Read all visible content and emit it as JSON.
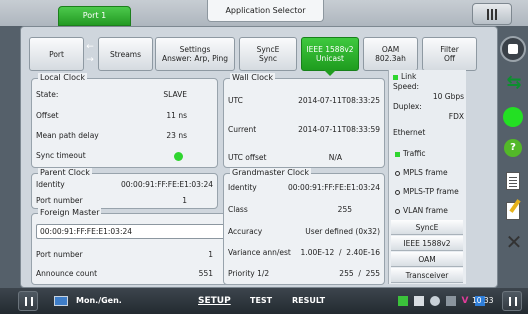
{
  "top": {
    "port_label": "Port 1",
    "app_selector_label": "Application Selector"
  },
  "tabs": [
    {
      "line1": "Port",
      "line2": ""
    },
    {
      "line1": "Streams",
      "line2": ""
    },
    {
      "line1": "Settings",
      "line2": "Answer: Arp, Ping"
    },
    {
      "line1": "SyncE",
      "line2": "Sync"
    },
    {
      "line1": "IEEE 1588v2",
      "line2": "Unicast"
    },
    {
      "line1": "OAM",
      "line2": "802.3ah"
    },
    {
      "line1": "Filter",
      "line2": "Off"
    }
  ],
  "local_clock": {
    "title": "Local Clock",
    "rows": [
      {
        "label": "State:",
        "value": "SLAVE"
      },
      {
        "label": "Offset",
        "value": "11 ns"
      },
      {
        "label": "Mean path delay",
        "value": "23 ns"
      },
      {
        "label": "Sync timeout",
        "value": ""
      }
    ]
  },
  "parent_clock": {
    "title": "Parent Clock",
    "rows": [
      {
        "label": "Identity",
        "value": "00:00:91:FF:FE:E1:03:24"
      },
      {
        "label": "Port number",
        "value": "1"
      }
    ]
  },
  "foreign_master": {
    "title": "Foreign Master",
    "selected": "00:00:91:FF:FE:E1:03:24",
    "rows": [
      {
        "label": "Port number",
        "value": "1"
      },
      {
        "label": "Announce count",
        "value": "551"
      }
    ]
  },
  "wall_clock": {
    "title": "Wall Clock",
    "rows": [
      {
        "label": "UTC",
        "value": "2014-07-11T08:33:25"
      },
      {
        "label": "Current",
        "value": "2014-07-11T08:33:59"
      },
      {
        "label": "UTC offset",
        "value": "N/A"
      }
    ]
  },
  "grandmaster_clock": {
    "title": "Grandmaster Clock",
    "rows": [
      {
        "label": "Identity",
        "value": "00:00:91:FF:FE:E1:03:24"
      },
      {
        "label": "Class",
        "value": "255"
      },
      {
        "label": "Accuracy",
        "value": "User defined (0x32)"
      },
      {
        "label": "Variance ann/est",
        "value": "1.00E-12  /  2.40E-16"
      },
      {
        "label": "Priority 1/2",
        "value": "255  /  255"
      }
    ]
  },
  "side_panel": {
    "link_label": "Link",
    "speed_label": "Speed:",
    "speed_value": "10 Gbps",
    "duplex_label": "Duplex:",
    "duplex_value": "FDX",
    "ethernet_label": "Ethernet",
    "traffic_label": "Traffic",
    "mpls_label": "MPLS frame",
    "mplstp_label": "MPLS-TP frame",
    "vlan_label": "VLAN frame",
    "buttons": [
      "SyncE",
      "IEEE 1588v2",
      "OAM",
      "Transceiver"
    ]
  },
  "bottom": {
    "mode_label": "Mon./Gen.",
    "setup_label": "SETUP",
    "test_label": "TEST",
    "result_label": "RESULT",
    "time": "10 33"
  },
  "colors": {
    "accent_green": "#23a823",
    "status_green": "#2fd52f"
  }
}
